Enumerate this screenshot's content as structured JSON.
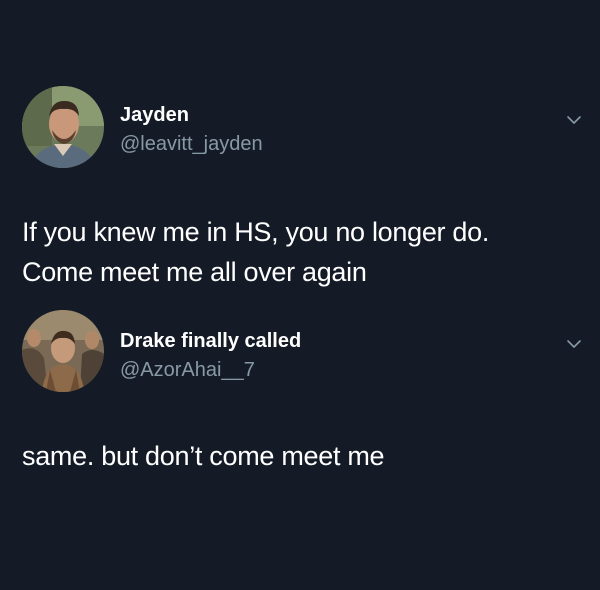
{
  "tweets": [
    {
      "display_name": "Jayden",
      "handle": "@leavitt_jayden",
      "avatar_icon": "profile-photo-man",
      "text_lines": [
        "If you knew me in HS, you no longer do.",
        "Come meet me all over again"
      ]
    },
    {
      "display_name": "Drake finally called",
      "handle": "@AzorAhai__7",
      "avatar_icon": "profile-photo-movie-still",
      "text_lines": [
        "same. but don’t come meet me"
      ]
    }
  ],
  "colors": {
    "background": "#151b26",
    "text": "#ffffff",
    "secondary_text": "#8899a6"
  }
}
